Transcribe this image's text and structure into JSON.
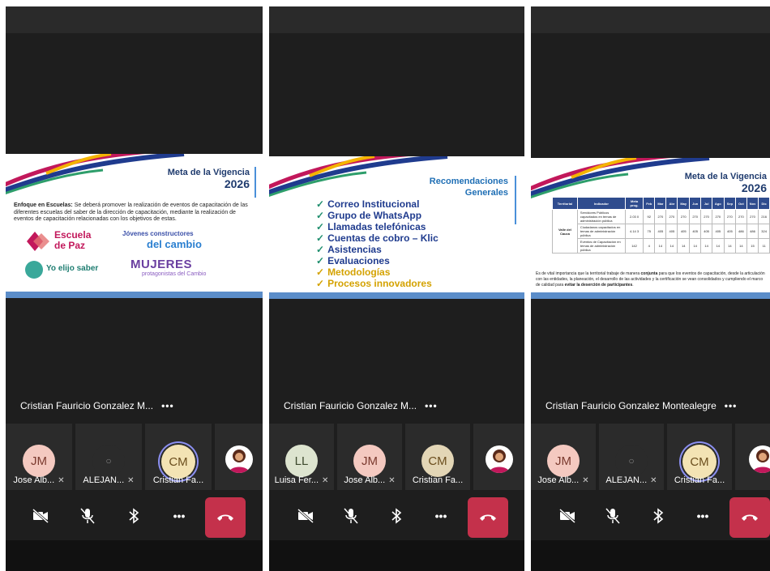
{
  "screens": [
    {
      "slide": {
        "title_line1": "Meta de la Vigencia",
        "title_line2": "2026",
        "body_bold": "Enfoque en Escuelas:",
        "body": " Se deberá promover la realización de eventos de capacitación de las diferentes escuelas del saber de la dirección de capacitación, mediante la realización de eventos de capacitación relacionadas con los objetivos de estas.",
        "logo1": "Escuela de Paz",
        "logo2_top": "Jóvenes constructores",
        "logo2_bottom": "del cambio",
        "logo3": "Yo elijo saber",
        "logo4": "MUJERES",
        "logo4_sub": "protagonistas del Cambio"
      },
      "presenter": "Cristian Fauricio Gonzalez M...",
      "tiles": [
        {
          "initials": "JM",
          "label": "Jose Alb...",
          "color": "#f4c9c0"
        },
        {
          "initials": "",
          "label": "ALEJAN...",
          "color": "#2b2b2b"
        },
        {
          "initials": "CM",
          "label": "Cristian Fa...",
          "color": "#f3e3b4"
        }
      ]
    },
    {
      "slide": {
        "title_line1": "Recomendaciones",
        "title_line2": "Generales",
        "items": [
          "Correo Institucional",
          "Grupo de WhatsApp",
          "Llamadas telefónicas",
          "Cuentas de cobro – Klic",
          "Asistencias",
          "Evaluaciones",
          "Metodologías",
          "Procesos innovadores"
        ]
      },
      "presenter": "Cristian Fauricio Gonzalez M...",
      "tiles": [
        {
          "initials": "LL",
          "label": "Luisa Fer...",
          "color": "#dde4cf"
        },
        {
          "initials": "JM",
          "label": "Jose Alb...",
          "color": "#f4c9c0"
        },
        {
          "initials": "CM",
          "label": "Cristian Fa...",
          "color": "#e3d6b6"
        }
      ]
    },
    {
      "slide": {
        "title_line1": "Meta de la Vigencia",
        "title_line2": "2026",
        "table_headers": [
          "Territorial",
          "Indicador",
          "Meta prog.",
          "Feb",
          "Mar",
          "Abr",
          "May",
          "Jun",
          "Jul",
          "Ago",
          "Sep",
          "Oct",
          "Nov",
          "Dic"
        ],
        "territorial": "Valle del Cauca",
        "rows": [
          [
            "Servidores Públicos capacitados en temas de administración pública",
            "2.03 0",
            "92",
            "270",
            "270",
            "270",
            "270",
            "270",
            "270",
            "270",
            "270",
            "270",
            "216"
          ],
          [
            "Ciudadanos capacitados en temas de administración pública",
            "4.14 3",
            "75",
            "405",
            "405",
            "405",
            "405",
            "405",
            "405",
            "405",
            "486",
            "486",
            "324"
          ],
          [
            "Eventos de Capacitación en temas de administración pública",
            "142",
            "4",
            "14",
            "14",
            "14",
            "14",
            "14",
            "14",
            "14",
            "14",
            "15",
            "11"
          ]
        ],
        "text_a": "Es de vital importancia que la territorial trabaje de manera ",
        "text_b": "conjunta",
        "text_c": " para que los eventos de capacitación, desde la articulación con las entidades, la planeación, el desarrollo de las actividades y la certificación se vean consolidados y cumpliendo el marco de calidad para ",
        "text_d": "evitar la deserción de participantes",
        "text_e": "."
      },
      "presenter": "Cristian Fauricio Gonzalez Montealegre",
      "tiles": [
        {
          "initials": "JM",
          "label": "Jose Alb...",
          "color": "#f4c9c0"
        },
        {
          "initials": "",
          "label": "ALEJAN...",
          "color": "#2b2b2b"
        },
        {
          "initials": "CM",
          "label": "Cristian Fa...",
          "color": "#f3e3b4"
        }
      ]
    }
  ],
  "controls": {
    "more_label": "•••"
  },
  "colors": {
    "end_call": "#c4314b",
    "call_bg": "#1e1e1e",
    "slide_blue": "#1f3b6e"
  }
}
